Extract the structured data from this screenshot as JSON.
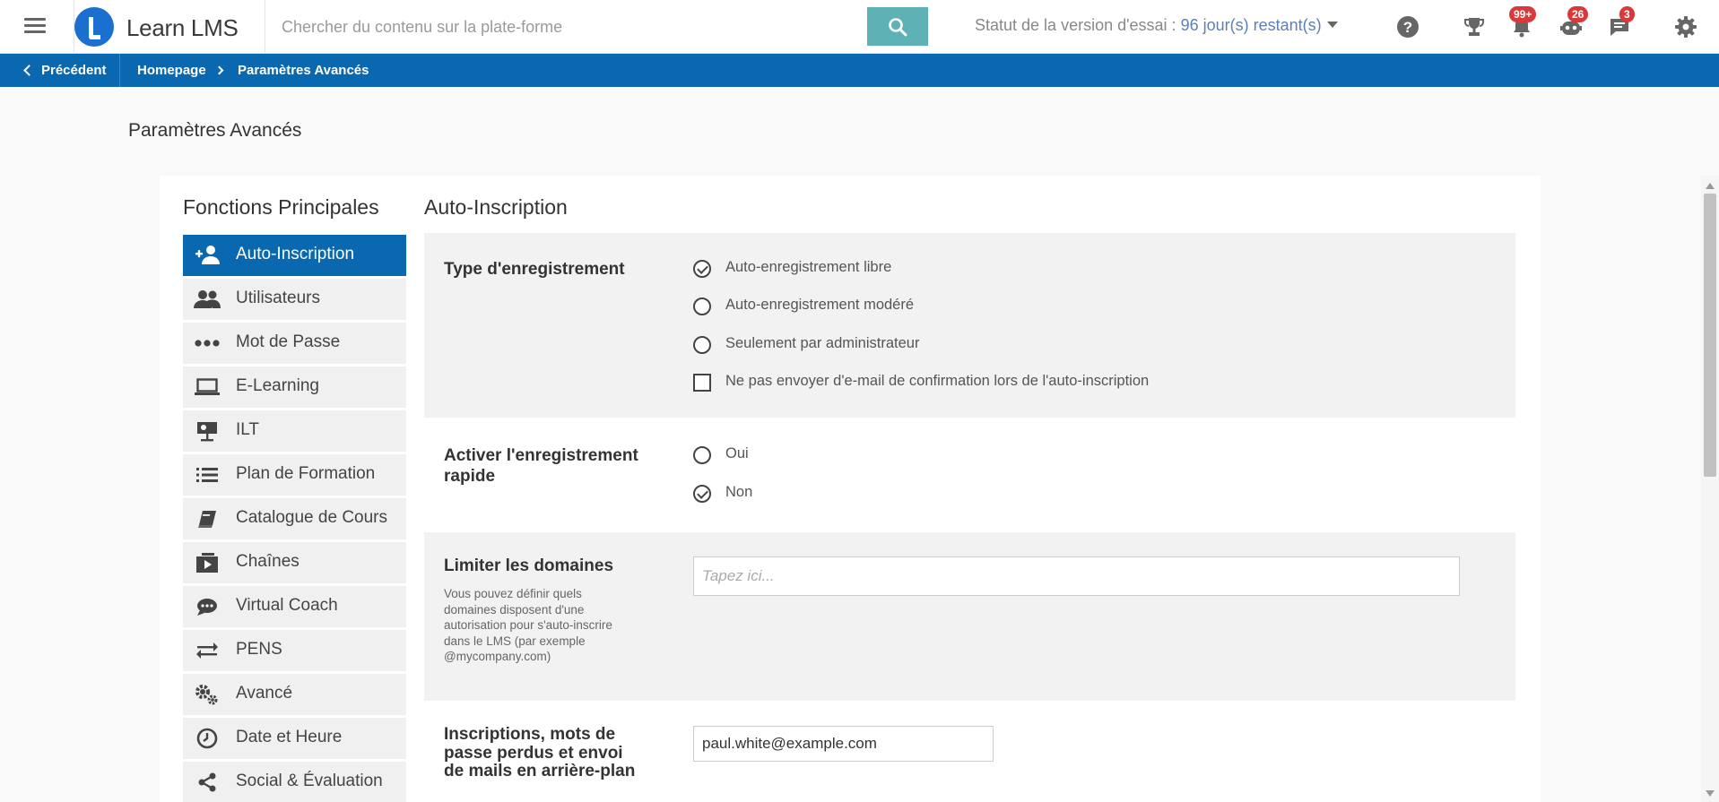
{
  "header": {
    "brand": "Learn LMS",
    "search_placeholder": "Chercher du contenu sur la plate-forme",
    "trial_prefix": "Statut de la version d'essai : ",
    "trial_days": "96 jour(s) restant(s)",
    "badges": {
      "notifications": "99+",
      "tutor": "26",
      "messages": "3"
    },
    "icons": [
      "menu-icon",
      "search-icon",
      "help-icon",
      "trophy-icon",
      "bell-icon",
      "robot-icon",
      "chat-icon",
      "gear-icon"
    ]
  },
  "breadcrumb": {
    "back": "Précédent",
    "home": "Homepage",
    "current": "Paramètres Avancés"
  },
  "page_title": "Paramètres Avancés",
  "sidebar": {
    "heading": "Fonctions Principales",
    "items": [
      {
        "label": "Auto-Inscription",
        "icon": "user-add-icon",
        "active": true
      },
      {
        "label": "Utilisateurs",
        "icon": "users-icon"
      },
      {
        "label": "Mot de Passe",
        "icon": "password-dots-icon"
      },
      {
        "label": "E-Learning",
        "icon": "laptop-icon"
      },
      {
        "label": "ILT",
        "icon": "presenter-icon"
      },
      {
        "label": "Plan de Formation",
        "icon": "list-icon"
      },
      {
        "label": "Catalogue de Cours",
        "icon": "book-icon"
      },
      {
        "label": "Chaînes",
        "icon": "channels-icon"
      },
      {
        "label": "Virtual Coach",
        "icon": "chat-bubble-icon"
      },
      {
        "label": "PENS",
        "icon": "arrows-exchange-icon"
      },
      {
        "label": "Avancé",
        "icon": "gears-icon"
      },
      {
        "label": "Date et Heure",
        "icon": "clock-icon"
      },
      {
        "label": "Social & Évaluation",
        "icon": "share-icon"
      }
    ]
  },
  "main": {
    "heading": "Auto-Inscription",
    "registration": {
      "title": "Type d'enregistrement",
      "options": [
        {
          "label": "Auto-enregistrement libre",
          "selected": true
        },
        {
          "label": "Auto-enregistrement modéré",
          "selected": false
        },
        {
          "label": "Seulement par administrateur",
          "selected": false
        }
      ],
      "checkbox_label": "Ne pas envoyer d'e-mail de confirmation lors de l'auto-inscription",
      "checkbox_checked": false
    },
    "quick_registration": {
      "title_line1": "Activer l'enregistrement",
      "title_line2": "rapide",
      "options": [
        {
          "label": "Oui",
          "selected": false
        },
        {
          "label": "Non",
          "selected": true
        }
      ]
    },
    "domains": {
      "title": "Limiter les domaines",
      "description": "Vous pouvez définir quels domaines disposent d'une autorisation pour s'auto-inscrire dans le LMS (par exemple @mycompany.com)",
      "placeholder": "Tapez ici..."
    },
    "email": {
      "title_line1": "Inscriptions, mots de",
      "title_line2": "passe perdus et envoi",
      "title_line3": "de mails en arrière-plan",
      "value": "paul.white@example.com"
    }
  },
  "colors": {
    "primary_blue": "#0a68b0",
    "search_button": "#5eb1b5",
    "badge_red": "#d9393b",
    "logo_blue": "#1b6fd1"
  }
}
